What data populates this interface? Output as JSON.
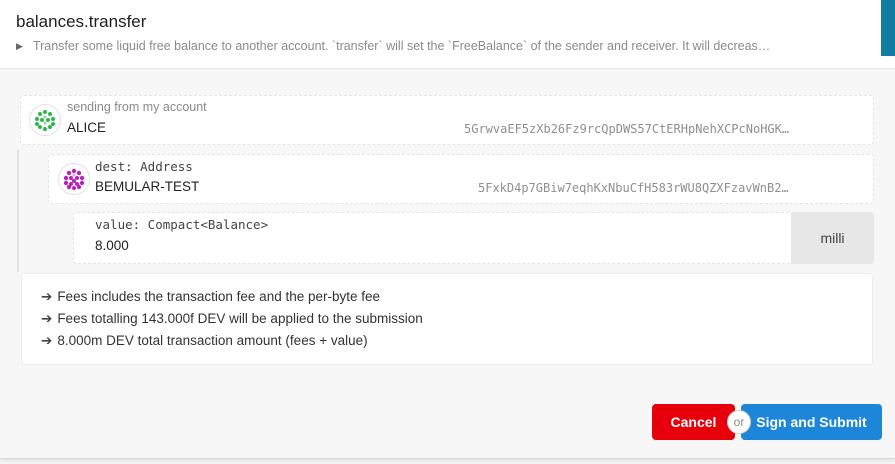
{
  "header": {
    "title": "balances.transfer",
    "description": "Transfer some liquid free balance to another account. `transfer` will set the `FreeBalance` of the sender and receiver. It will decreas…",
    "expand_icon": "triangle-right-icon"
  },
  "sender": {
    "label": "sending from my account",
    "name": "ALICE",
    "address": "5GrwvaEF5zXb26Fz9rcQpDWS57CtERHpNehXCPcNoHGK…",
    "avatar_color": "#2fb84a"
  },
  "dest": {
    "label": "dest: Address",
    "name": "BEMULAR-TEST",
    "address": "5FxkD4p7GBiw7eqhKxNbuCfH583rWU8QZXFzavWnB2…",
    "avatar_color": "#b425b9"
  },
  "value": {
    "label": "value: Compact<Balance>",
    "amount": "8.000",
    "unit": "milli"
  },
  "fees": [
    "Fees includes the transaction fee and the per-byte fee",
    "Fees totalling 143.000f DEV will be applied to the submission",
    "8.000m DEV total transaction amount (fees + value)"
  ],
  "fee_arrow": "➔",
  "actions": {
    "cancel": "Cancel",
    "or": "or",
    "submit": "Sign and Submit"
  },
  "colors": {
    "cancel": "#e7000b",
    "submit": "#1d86d9",
    "accent": "#0f7ea1"
  }
}
